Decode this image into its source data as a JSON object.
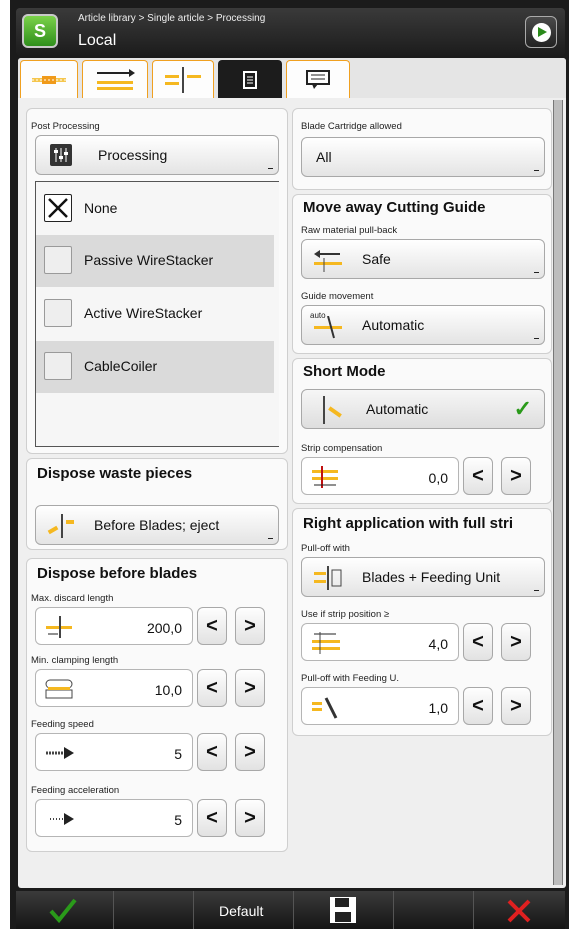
{
  "header": {
    "breadcrumb": "Article library > Single article > Processing",
    "title": "Local",
    "logo_text": "S"
  },
  "tabs": [
    {
      "icon": "wire-ends-icon"
    },
    {
      "icon": "strip-arrows-icon"
    },
    {
      "icon": "blade-split-icon"
    },
    {
      "icon": "document-icon",
      "active": true
    },
    {
      "icon": "message-icon"
    }
  ],
  "post_processing": {
    "label": "Post Processing",
    "dropdown_value": "Processing",
    "options": [
      {
        "label": "None",
        "checked": true
      },
      {
        "label": "Passive WireStacker",
        "checked": false
      },
      {
        "label": "Active WireStacker",
        "checked": false
      },
      {
        "label": "CableCoiler",
        "checked": false
      }
    ]
  },
  "blade_cartridge": {
    "label": "Blade Cartridge allowed",
    "value": "All"
  },
  "move_away": {
    "title": "Move away Cutting Guide",
    "pullback_label": "Raw material pull-back",
    "pullback_value": "Safe",
    "guide_label": "Guide movement",
    "guide_value": "Automatic",
    "guide_icon_text": "auto"
  },
  "short_mode": {
    "title": "Short Mode",
    "value": "Automatic",
    "check": "✓",
    "strip_comp_label": "Strip compensation",
    "strip_comp_value": "0,0"
  },
  "right_app": {
    "title": "Right application with full stri",
    "pulloff_label": "Pull-off with",
    "pulloff_value": "Blades + Feeding Unit",
    "strip_pos_label": "Use if strip position ≥",
    "strip_pos_value": "4,0",
    "pulloff_feed_label": "Pull-off with Feeding U.",
    "pulloff_feed_value": "1,0"
  },
  "dispose_waste": {
    "title": "Dispose waste pieces",
    "value": "Before Blades; eject"
  },
  "dispose_before": {
    "title": "Dispose before blades",
    "fields": [
      {
        "label": "Max. discard length",
        "value": "200,0"
      },
      {
        "label": "Min. clamping length",
        "value": "10,0"
      },
      {
        "label": "Feeding speed",
        "value": "5"
      },
      {
        "label": "Feeding acceleration",
        "value": "5"
      }
    ]
  },
  "stepper": {
    "prev": "<",
    "next": ">"
  },
  "footer": {
    "default_label": "Default"
  },
  "colors": {
    "accent_orange": "#f0a020",
    "ok_green": "#2a9a1a",
    "cancel_red": "#e02020"
  }
}
